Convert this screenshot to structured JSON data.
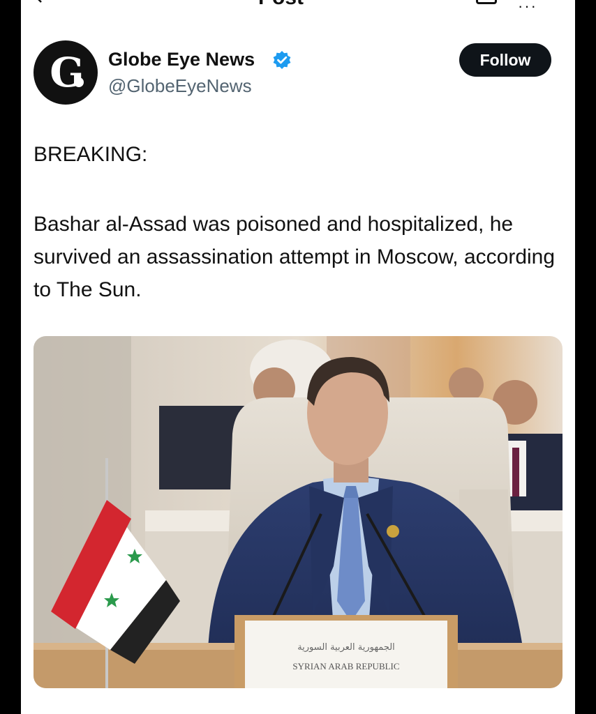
{
  "header": {
    "title": "Post"
  },
  "account": {
    "display_name": "Globe Eye News",
    "handle": "@GlobeEyeNews",
    "avatar_letter": "G.",
    "verified": true,
    "follow_label": "Follow"
  },
  "post": {
    "heading": "BREAKING:",
    "text": "Bashar al-Assad was poisoned and hospitalized, he survived an assassination attempt in Moscow, according to The Sun.",
    "image": {
      "placard_arabic": "الجمهورية العربية السورية",
      "placard_english": "SYRIAN ARAB REPUBLIC"
    }
  },
  "colors": {
    "verified": "#1d9bf0",
    "follow_bg": "#0f1419",
    "handle": "#536471"
  }
}
